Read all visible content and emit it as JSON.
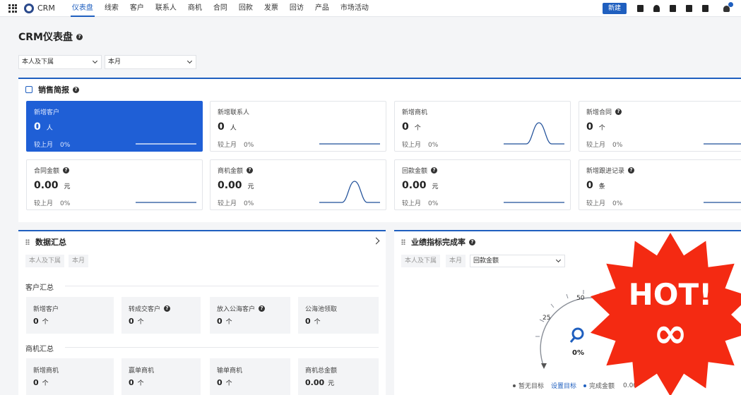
{
  "app": {
    "name": "CRM"
  },
  "nav": {
    "items": [
      "仪表盘",
      "线索",
      "客户",
      "联系人",
      "商机",
      "合同",
      "回款",
      "发票",
      "回访",
      "产品",
      "市场活动"
    ],
    "active_index": 0
  },
  "toolbar": {
    "new_label": "新建",
    "notification_count": "2"
  },
  "page": {
    "title": "CRM仪表盘",
    "help": "?"
  },
  "filters": {
    "scope": "本人及下属",
    "period": "本月"
  },
  "sales_report": {
    "title": "销售简报",
    "compare_label": "较上月",
    "cards": [
      {
        "title": "新增客户",
        "value": "0",
        "unit": "人",
        "compare": "0%",
        "help": false
      },
      {
        "title": "新增联系人",
        "value": "0",
        "unit": "人",
        "compare": "0%",
        "help": false
      },
      {
        "title": "新增商机",
        "value": "0",
        "unit": "个",
        "compare": "0%",
        "help": false
      },
      {
        "title": "新增合同",
        "value": "0",
        "unit": "个",
        "compare": "0%",
        "help": true
      },
      {
        "title": "合同金额",
        "value": "0.00",
        "unit": "元",
        "compare": "0%",
        "help": true
      },
      {
        "title": "商机金额",
        "value": "0.00",
        "unit": "元",
        "compare": "0%",
        "help": true
      },
      {
        "title": "回款金额",
        "value": "0.00",
        "unit": "元",
        "compare": "0%",
        "help": true
      },
      {
        "title": "新增跟进记录",
        "value": "0",
        "unit": "条",
        "compare": "0%",
        "help": true
      }
    ]
  },
  "data_summary": {
    "title": "数据汇总",
    "chips": [
      "本人及下属",
      "本月"
    ],
    "customer_section": "客户汇总",
    "customer_cards": [
      {
        "title": "新增客户",
        "value": "0",
        "unit": "个",
        "help": false
      },
      {
        "title": "转成交客户",
        "value": "0",
        "unit": "个",
        "help": true
      },
      {
        "title": "放入公海客户",
        "value": "0",
        "unit": "个",
        "help": true
      },
      {
        "title": "公海池领取",
        "value": "0",
        "unit": "个",
        "help": false
      }
    ],
    "opportunity_section": "商机汇总",
    "opportunity_cards": [
      {
        "title": "新增商机",
        "value": "0",
        "unit": "个"
      },
      {
        "title": "赢单商机",
        "value": "0",
        "unit": "个"
      },
      {
        "title": "输单商机",
        "value": "0",
        "unit": "个"
      },
      {
        "title": "商机总金额",
        "value": "0.00",
        "unit": "元"
      }
    ]
  },
  "performance": {
    "title": "业绩指标完成率",
    "chips": [
      "本人及下属",
      "本月"
    ],
    "metric_select": "回款金额",
    "gauge_labels": [
      "25",
      "50"
    ],
    "gauge_percent": "0%",
    "legend": [
      "暂无目标",
      "设置目标",
      "完成金额",
      "0.00"
    ]
  },
  "overlay_badge": {
    "line1": "HOT!",
    "line2": "∞"
  },
  "colors": {
    "accent": "#1f5fbf",
    "highlight_card": "#1f5fd6",
    "badge": "#f42a12"
  }
}
